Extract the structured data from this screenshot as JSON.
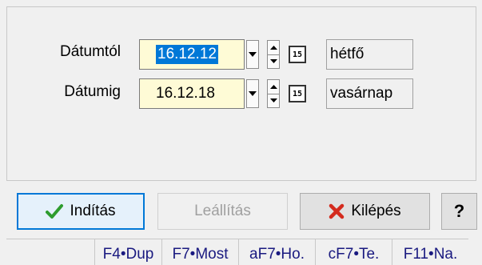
{
  "form": {
    "from_label": "Dátumtól",
    "from_value": "16.12.12",
    "from_day": "hétfő",
    "to_label": "Dátumig",
    "to_value": "16.12.18",
    "to_day": "vasárnap",
    "calendar_glyph": "15"
  },
  "buttons": {
    "start": "Indítás",
    "stop": "Leállítás",
    "exit": "Kilépés",
    "help": "?"
  },
  "status_bar": [
    "",
    "F4•Dup",
    "F7•Most",
    "aF7•Ho.",
    "cF7•Te.",
    "F11•Na."
  ],
  "colors": {
    "input_bg": "#fefbd6",
    "selection": "#0078d7",
    "check": "#2e9c2e",
    "cross": "#d42b1e",
    "status_text": "#1a1a80"
  },
  "icons": {
    "start": "check-icon",
    "exit": "close-icon",
    "dropdown": "chevron-down-icon",
    "spin": "spin-icon",
    "calendar": "calendar-icon"
  }
}
